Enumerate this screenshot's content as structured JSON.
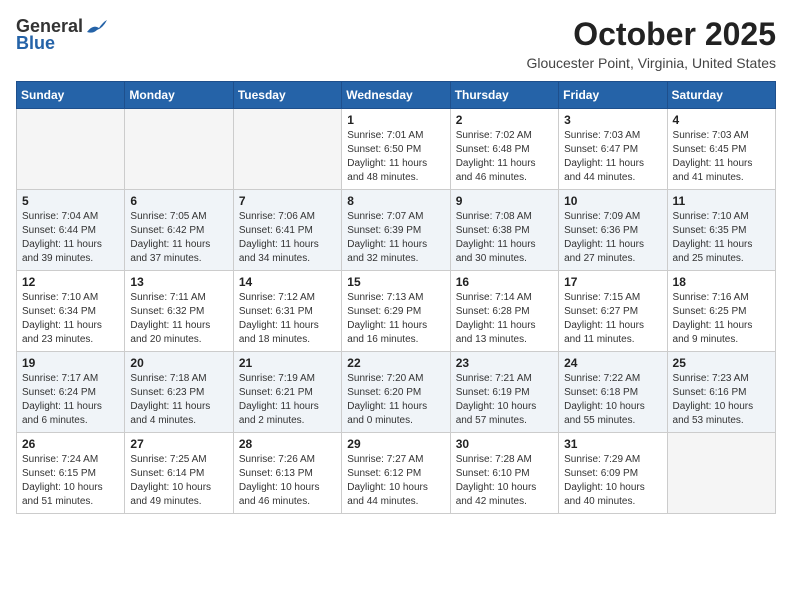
{
  "logo": {
    "general": "General",
    "blue": "Blue"
  },
  "title": "October 2025",
  "location": "Gloucester Point, Virginia, United States",
  "days": [
    "Sunday",
    "Monday",
    "Tuesday",
    "Wednesday",
    "Thursday",
    "Friday",
    "Saturday"
  ],
  "weeks": [
    [
      {
        "date": "",
        "info": ""
      },
      {
        "date": "",
        "info": ""
      },
      {
        "date": "",
        "info": ""
      },
      {
        "date": "1",
        "info": "Sunrise: 7:01 AM\nSunset: 6:50 PM\nDaylight: 11 hours\nand 48 minutes."
      },
      {
        "date": "2",
        "info": "Sunrise: 7:02 AM\nSunset: 6:48 PM\nDaylight: 11 hours\nand 46 minutes."
      },
      {
        "date": "3",
        "info": "Sunrise: 7:03 AM\nSunset: 6:47 PM\nDaylight: 11 hours\nand 44 minutes."
      },
      {
        "date": "4",
        "info": "Sunrise: 7:03 AM\nSunset: 6:45 PM\nDaylight: 11 hours\nand 41 minutes."
      }
    ],
    [
      {
        "date": "5",
        "info": "Sunrise: 7:04 AM\nSunset: 6:44 PM\nDaylight: 11 hours\nand 39 minutes."
      },
      {
        "date": "6",
        "info": "Sunrise: 7:05 AM\nSunset: 6:42 PM\nDaylight: 11 hours\nand 37 minutes."
      },
      {
        "date": "7",
        "info": "Sunrise: 7:06 AM\nSunset: 6:41 PM\nDaylight: 11 hours\nand 34 minutes."
      },
      {
        "date": "8",
        "info": "Sunrise: 7:07 AM\nSunset: 6:39 PM\nDaylight: 11 hours\nand 32 minutes."
      },
      {
        "date": "9",
        "info": "Sunrise: 7:08 AM\nSunset: 6:38 PM\nDaylight: 11 hours\nand 30 minutes."
      },
      {
        "date": "10",
        "info": "Sunrise: 7:09 AM\nSunset: 6:36 PM\nDaylight: 11 hours\nand 27 minutes."
      },
      {
        "date": "11",
        "info": "Sunrise: 7:10 AM\nSunset: 6:35 PM\nDaylight: 11 hours\nand 25 minutes."
      }
    ],
    [
      {
        "date": "12",
        "info": "Sunrise: 7:10 AM\nSunset: 6:34 PM\nDaylight: 11 hours\nand 23 minutes."
      },
      {
        "date": "13",
        "info": "Sunrise: 7:11 AM\nSunset: 6:32 PM\nDaylight: 11 hours\nand 20 minutes."
      },
      {
        "date": "14",
        "info": "Sunrise: 7:12 AM\nSunset: 6:31 PM\nDaylight: 11 hours\nand 18 minutes."
      },
      {
        "date": "15",
        "info": "Sunrise: 7:13 AM\nSunset: 6:29 PM\nDaylight: 11 hours\nand 16 minutes."
      },
      {
        "date": "16",
        "info": "Sunrise: 7:14 AM\nSunset: 6:28 PM\nDaylight: 11 hours\nand 13 minutes."
      },
      {
        "date": "17",
        "info": "Sunrise: 7:15 AM\nSunset: 6:27 PM\nDaylight: 11 hours\nand 11 minutes."
      },
      {
        "date": "18",
        "info": "Sunrise: 7:16 AM\nSunset: 6:25 PM\nDaylight: 11 hours\nand 9 minutes."
      }
    ],
    [
      {
        "date": "19",
        "info": "Sunrise: 7:17 AM\nSunset: 6:24 PM\nDaylight: 11 hours\nand 6 minutes."
      },
      {
        "date": "20",
        "info": "Sunrise: 7:18 AM\nSunset: 6:23 PM\nDaylight: 11 hours\nand 4 minutes."
      },
      {
        "date": "21",
        "info": "Sunrise: 7:19 AM\nSunset: 6:21 PM\nDaylight: 11 hours\nand 2 minutes."
      },
      {
        "date": "22",
        "info": "Sunrise: 7:20 AM\nSunset: 6:20 PM\nDaylight: 11 hours\nand 0 minutes."
      },
      {
        "date": "23",
        "info": "Sunrise: 7:21 AM\nSunset: 6:19 PM\nDaylight: 10 hours\nand 57 minutes."
      },
      {
        "date": "24",
        "info": "Sunrise: 7:22 AM\nSunset: 6:18 PM\nDaylight: 10 hours\nand 55 minutes."
      },
      {
        "date": "25",
        "info": "Sunrise: 7:23 AM\nSunset: 6:16 PM\nDaylight: 10 hours\nand 53 minutes."
      }
    ],
    [
      {
        "date": "26",
        "info": "Sunrise: 7:24 AM\nSunset: 6:15 PM\nDaylight: 10 hours\nand 51 minutes."
      },
      {
        "date": "27",
        "info": "Sunrise: 7:25 AM\nSunset: 6:14 PM\nDaylight: 10 hours\nand 49 minutes."
      },
      {
        "date": "28",
        "info": "Sunrise: 7:26 AM\nSunset: 6:13 PM\nDaylight: 10 hours\nand 46 minutes."
      },
      {
        "date": "29",
        "info": "Sunrise: 7:27 AM\nSunset: 6:12 PM\nDaylight: 10 hours\nand 44 minutes."
      },
      {
        "date": "30",
        "info": "Sunrise: 7:28 AM\nSunset: 6:10 PM\nDaylight: 10 hours\nand 42 minutes."
      },
      {
        "date": "31",
        "info": "Sunrise: 7:29 AM\nSunset: 6:09 PM\nDaylight: 10 hours\nand 40 minutes."
      },
      {
        "date": "",
        "info": ""
      }
    ]
  ]
}
